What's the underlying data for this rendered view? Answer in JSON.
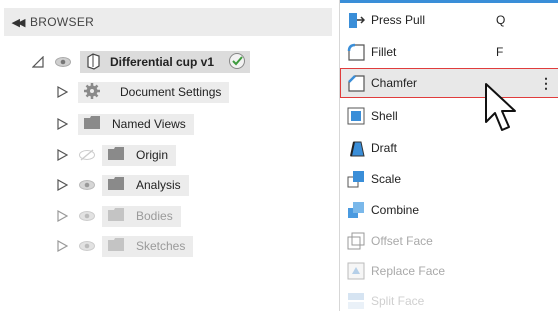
{
  "browser": {
    "title": "BROWSER",
    "root": {
      "label": "Differential cup v1"
    },
    "items": [
      {
        "label": "Document Settings"
      },
      {
        "label": "Named Views"
      },
      {
        "label": "Origin"
      },
      {
        "label": "Analysis"
      },
      {
        "label": "Bodies"
      },
      {
        "label": "Sketches"
      }
    ]
  },
  "menu": {
    "items": [
      {
        "label": "Press Pull",
        "shortcut": "Q",
        "icon": "press-pull-icon"
      },
      {
        "label": "Fillet",
        "shortcut": "F",
        "icon": "fillet-icon"
      },
      {
        "label": "Chamfer",
        "shortcut": "",
        "icon": "chamfer-icon",
        "more": "⋮"
      },
      {
        "label": "Shell",
        "icon": "shell-icon"
      },
      {
        "label": "Draft",
        "icon": "draft-icon"
      },
      {
        "label": "Scale",
        "icon": "scale-icon"
      },
      {
        "label": "Combine",
        "icon": "combine-icon"
      },
      {
        "label": "Offset Face",
        "icon": "offset-face-icon"
      },
      {
        "label": "Replace Face",
        "icon": "replace-face-icon"
      },
      {
        "label": "Split Face",
        "icon": "split-face-icon"
      }
    ]
  },
  "colors": {
    "accent": "#3a8ed8",
    "highlight_border": "#e03c3c",
    "check": "#4caf50"
  }
}
